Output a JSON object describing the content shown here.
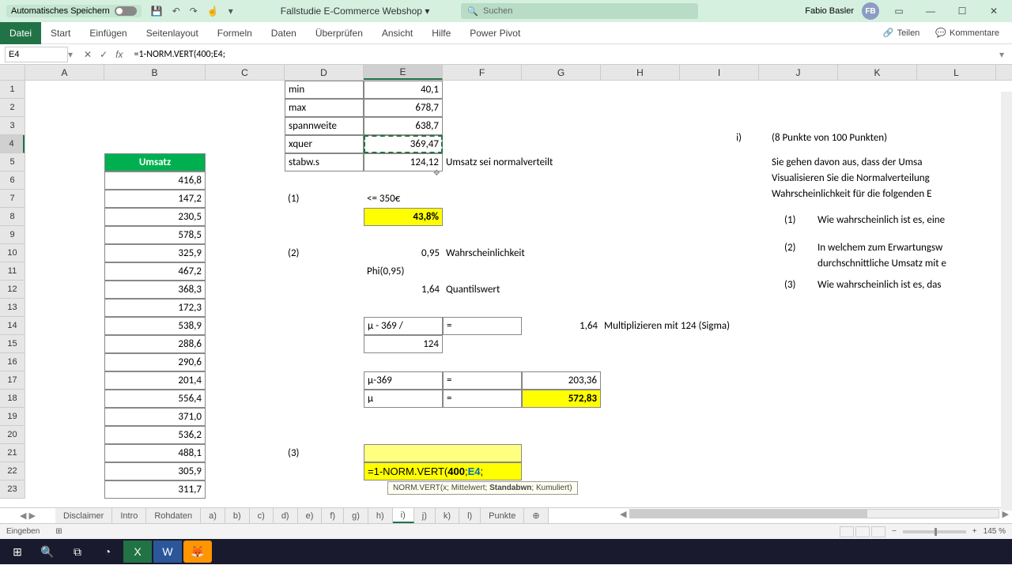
{
  "titlebar": {
    "autosave": "Automatisches Speichern",
    "doc": "Fallstudie E-Commerce Webshop",
    "search_placeholder": "Suchen",
    "user": "Fabio Basler",
    "initials": "FB"
  },
  "ribbon": {
    "tabs": [
      "Datei",
      "Start",
      "Einfügen",
      "Seitenlayout",
      "Formeln",
      "Daten",
      "Überprüfen",
      "Ansicht",
      "Hilfe",
      "Power Pivot"
    ],
    "share": "Teilen",
    "comments": "Kommentare"
  },
  "fbar": {
    "namebox": "E4",
    "formula": "=1-NORM.VERT(400;E4;"
  },
  "cols": [
    "A",
    "B",
    "C",
    "D",
    "E",
    "F",
    "G",
    "H",
    "I",
    "J",
    "K",
    "L"
  ],
  "rows": [
    "1",
    "2",
    "3",
    "4",
    "5",
    "6",
    "7",
    "8",
    "9",
    "10",
    "11",
    "12",
    "13",
    "14",
    "15",
    "16",
    "17",
    "18",
    "19",
    "20",
    "21",
    "22",
    "23"
  ],
  "colB": {
    "header": "Umsatz",
    "vals": [
      "416,8",
      "147,2",
      "230,5",
      "578,5",
      "325,9",
      "467,2",
      "368,3",
      "172,3",
      "538,9",
      "288,6",
      "290,6",
      "201,4",
      "556,4",
      "371,0",
      "536,2",
      "488,1",
      "305,9",
      "311,7"
    ]
  },
  "colD": {
    "r1": "min",
    "r2": "max",
    "r3": "spannweite",
    "r4": "xquer",
    "r5": "stabw.s",
    "r7": "(1)",
    "r10": "(2)",
    "r21": "(3)"
  },
  "colE": {
    "r1": "40,1",
    "r2": "678,7",
    "r3": "638,7",
    "r4": "369,47",
    "r5": "124,12",
    "r7": "<= 350€",
    "r8": "43,8%",
    "r10": "0,95",
    "r11": "Phi(0,95)",
    "r12": "1,64",
    "r14": "μ - 369 /",
    "r15": "124",
    "r17": "μ-369",
    "r18": "μ"
  },
  "colF": {
    "r5": "Umsatz sei normalverteilt",
    "r10": "Wahrscheinlichkeit",
    "r12": "Quantilswert",
    "r14": "=",
    "r17": "=",
    "r18": "="
  },
  "colG": {
    "r14": "1,64",
    "r17": "203,36",
    "r18": "572,83"
  },
  "colH": {
    "r14": "Multiplizieren mit 124 (Sigma)"
  },
  "right_text": {
    "i_label": "i)",
    "title": "(8 Punkte von 100 Punkten)",
    "p1": "Sie gehen davon aus, dass der Umsa",
    "p2": "Visualisieren Sie die Normalverteilung",
    "p3": "Wahrscheinlichkeit für die folgenden E",
    "q1_n": "(1)",
    "q1": "Wie wahrscheinlich ist es, eine",
    "q2_n": "(2)",
    "q2": "In welchem zum Erwartungsw",
    "q2b": "durchschnittliche Umsatz mit e",
    "q3_n": "(3)",
    "q3": "Wie wahrscheinlich ist es, das"
  },
  "formula_cell": {
    "prefix": "=1-NORM.VERT(",
    "arg1": "400",
    "semi": ";",
    "arg2": "E4",
    "tail": ";"
  },
  "tooltip": {
    "fn": "NORM.VERT",
    "sig_pre": "(x; Mittelwert; ",
    "sig_cur": "Standabwn",
    "sig_post": "; Kumuliert)"
  },
  "sheets": [
    "Disclaimer",
    "Intro",
    "Rohdaten",
    "a)",
    "b)",
    "c)",
    "d)",
    "e)",
    "f)",
    "g)",
    "h)",
    "i)",
    "j)",
    "k)",
    "l)",
    "Punkte"
  ],
  "active_sheet": "i)",
  "status": {
    "mode": "Eingeben",
    "zoom": "145 %"
  }
}
